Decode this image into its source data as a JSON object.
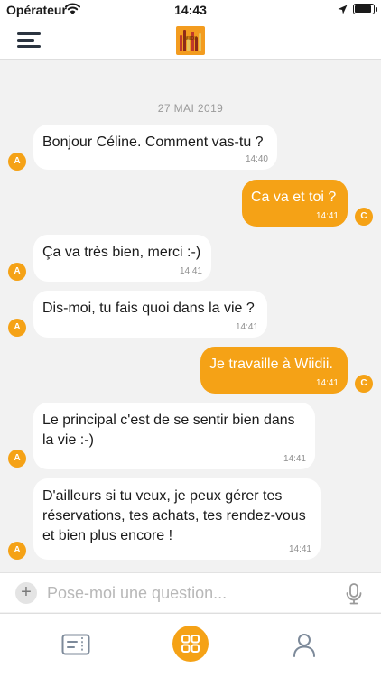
{
  "status_bar": {
    "carrier": "Opérateur",
    "time": "14:43",
    "battery_level": 0.9
  },
  "header": {
    "logo_text": "WIIDII"
  },
  "chat": {
    "date": "27 MAI 2019",
    "messages": [
      {
        "from": "bot",
        "avatar": "A",
        "text": "Bonjour Céline. Comment vas-tu ?",
        "time": "14:40"
      },
      {
        "from": "user",
        "avatar": "C",
        "text": "Ca va et toi ?",
        "time": "14:41"
      },
      {
        "from": "bot",
        "avatar": "A",
        "text": "Ça va très bien, merci :-)",
        "time": "14:41"
      },
      {
        "from": "bot",
        "avatar": "A",
        "text": "Dis-moi, tu fais quoi dans la vie ?",
        "time": "14:41"
      },
      {
        "from": "user",
        "avatar": "C",
        "text": "Je travaille à Wiidii.",
        "time": "14:41"
      },
      {
        "from": "bot",
        "avatar": "A",
        "text": "Le principal c'est de se sentir bien dans la vie :-)",
        "time": "14:41"
      },
      {
        "from": "bot",
        "avatar": "A",
        "text": "D'ailleurs si tu veux, je peux gérer tes réservations, tes achats, tes rendez-vous et bien plus encore !",
        "time": "14:41"
      }
    ]
  },
  "composer": {
    "placeholder": "Pose-moi une question...",
    "plus_label": "+"
  },
  "tab_bar": {
    "items": [
      "ticket-icon",
      "apps-grid-icon",
      "profile-icon"
    ],
    "active_index": 1
  },
  "colors": {
    "accent": "#f5a216",
    "background": "#f2f2f2",
    "bubble_in": "#ffffff"
  }
}
